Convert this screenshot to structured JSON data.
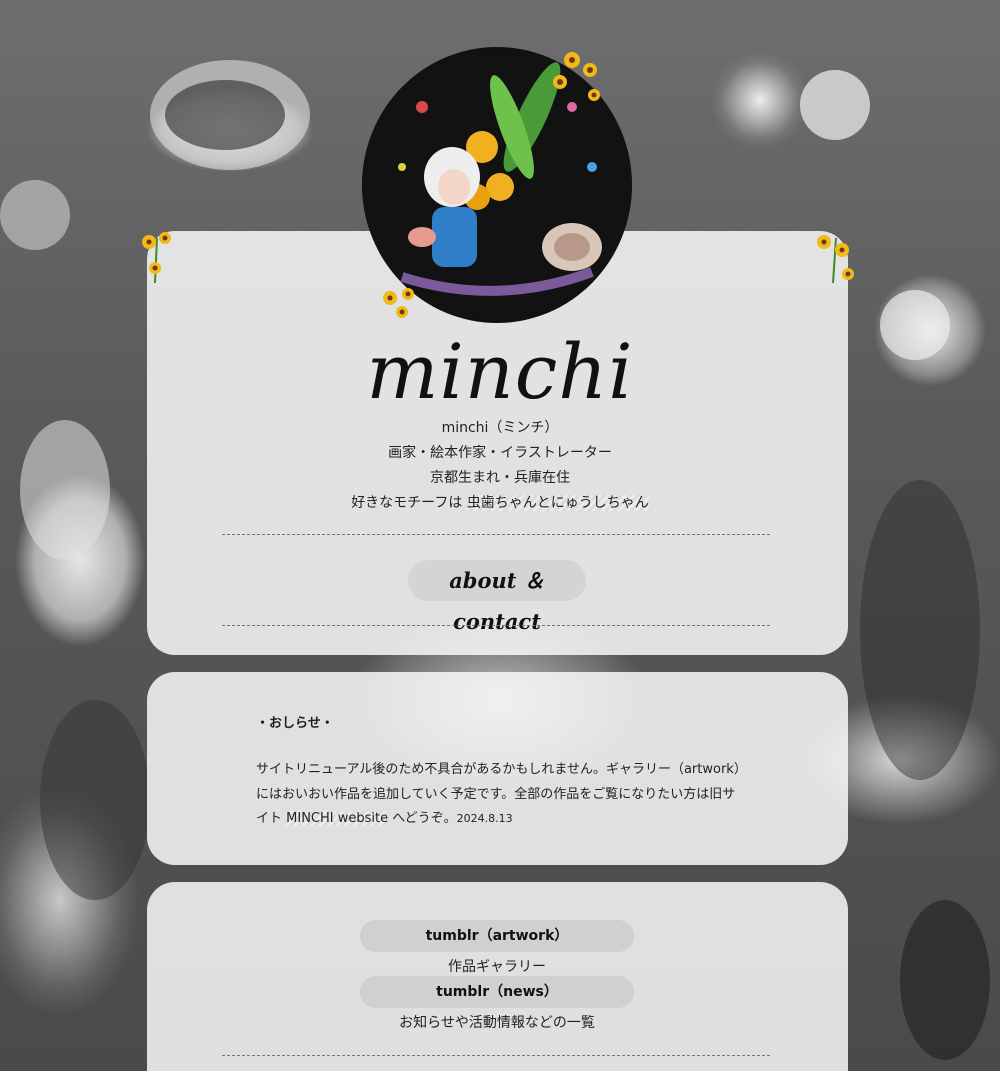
{
  "site": {
    "title": "minchi",
    "name_line": "minchi（ミンチ）",
    "role_line": "画家・絵本作家・イラストレーター",
    "origin_line": "京都生まれ・兵庫在住",
    "motif_prefix": "好きなモチーフは ",
    "motif_highlight": "虫歯ちゃんとにゅうしちゃん"
  },
  "about_button": "about ＆ contact",
  "notice": {
    "title": "・おしらせ・",
    "body_part1": "サイトリニューアル後のため不具合があるかもしれません。ギャラリー（artwork）にはおいおい作品を追加していく予定です。全部の作品をご覧になりたい方は旧サイト ",
    "body_link": "MINCHI website",
    "body_part2": " へどうぞ。",
    "date": "2024.8.13"
  },
  "links": [
    {
      "label": "tumblr（artwork）",
      "description": "作品ギャラリー"
    },
    {
      "label": "tumblr（news）",
      "description": "お知らせや活動情報などの一覧"
    }
  ],
  "icons": {
    "avatar": "illustration-avatar",
    "flower": "sunflower-icon"
  },
  "colors": {
    "card_bg": "#f8f8f8",
    "pill_bg": "#d0d0d0",
    "text": "#1e1e1e"
  }
}
